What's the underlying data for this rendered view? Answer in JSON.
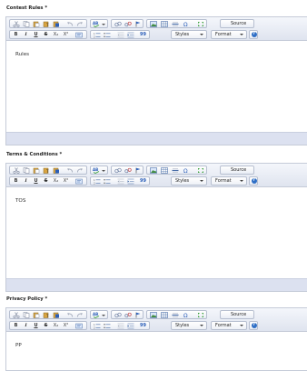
{
  "sections": [
    {
      "key": "rules",
      "label": "Contest Rules *",
      "content": "Rules"
    },
    {
      "key": "terms",
      "label": "Terms & Conditions *",
      "content": "TOS"
    },
    {
      "key": "privacy",
      "label": "Privacy Policy *",
      "content": "PP"
    }
  ],
  "toolbar": {
    "source_label": "Source",
    "styles_label": "Styles",
    "format_label": "Format",
    "bold": "B",
    "italic": "I",
    "underline": "U",
    "strike": "S",
    "subscript": "X₂",
    "superscript": "X²",
    "blockquote": "99"
  },
  "colors": {
    "toolbar_top": "#f4f6fb",
    "toolbar_bottom": "#dfe4ef",
    "footer": "#dce1f0",
    "border": "#c5cbd8",
    "accent_blue": "#2f6fc6",
    "maximize_green": "#3aa13a",
    "source_red": "#cc2a2a"
  }
}
